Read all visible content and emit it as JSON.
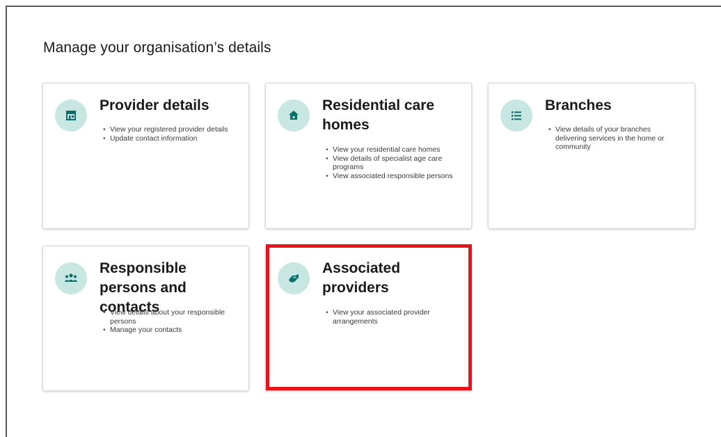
{
  "page": {
    "title": "Manage your organisation’s details"
  },
  "cards": [
    {
      "title": "Provider details",
      "icon": "storefront-icon",
      "bullets": [
        "View your registered provider details",
        "Update contact information"
      ]
    },
    {
      "title": "Residential care homes",
      "icon": "home-icon",
      "bullets": [
        "View your residential care homes",
        "View details of specialist age care programs",
        "View associated responsible persons"
      ]
    },
    {
      "title": "Branches",
      "icon": "list-icon",
      "bullets": [
        "View details of your branches delivering services in the home or community"
      ]
    },
    {
      "title": "Responsible persons and contacts",
      "icon": "people-icon",
      "bullets": [
        "View details about your responsible persons",
        "Manage your contacts"
      ]
    },
    {
      "title": "Associated providers",
      "icon": "handshake-icon",
      "bullets": [
        "View your associated provider arrangements"
      ]
    }
  ],
  "colors": {
    "icon_background": "#c8e7e3",
    "icon_foreground": "#0b6e6a",
    "highlight": "#e8141b",
    "frame": "#55566a"
  }
}
